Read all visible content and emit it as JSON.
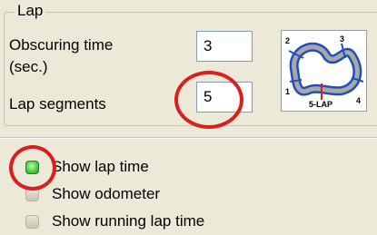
{
  "group": {
    "title": "Lap"
  },
  "obscuring_time": {
    "label": "Obscuring time",
    "unit": "(sec.)",
    "value": "3"
  },
  "lap_segments": {
    "label": "Lap segments",
    "value": "5"
  },
  "preview": {
    "caption": "5-LAP",
    "segment_numbers": [
      "1",
      "2",
      "3",
      "4"
    ]
  },
  "checkboxes": [
    {
      "label": "Show lap time",
      "checked": true
    },
    {
      "label": "Show odometer",
      "checked": false
    },
    {
      "label": "Show running lap time",
      "checked": false
    }
  ],
  "colors": {
    "highlight": "#d9201f",
    "check_green": "#3fbf38",
    "track_blue": "#1f4fbf",
    "track_gray": "#8a8a8a"
  }
}
